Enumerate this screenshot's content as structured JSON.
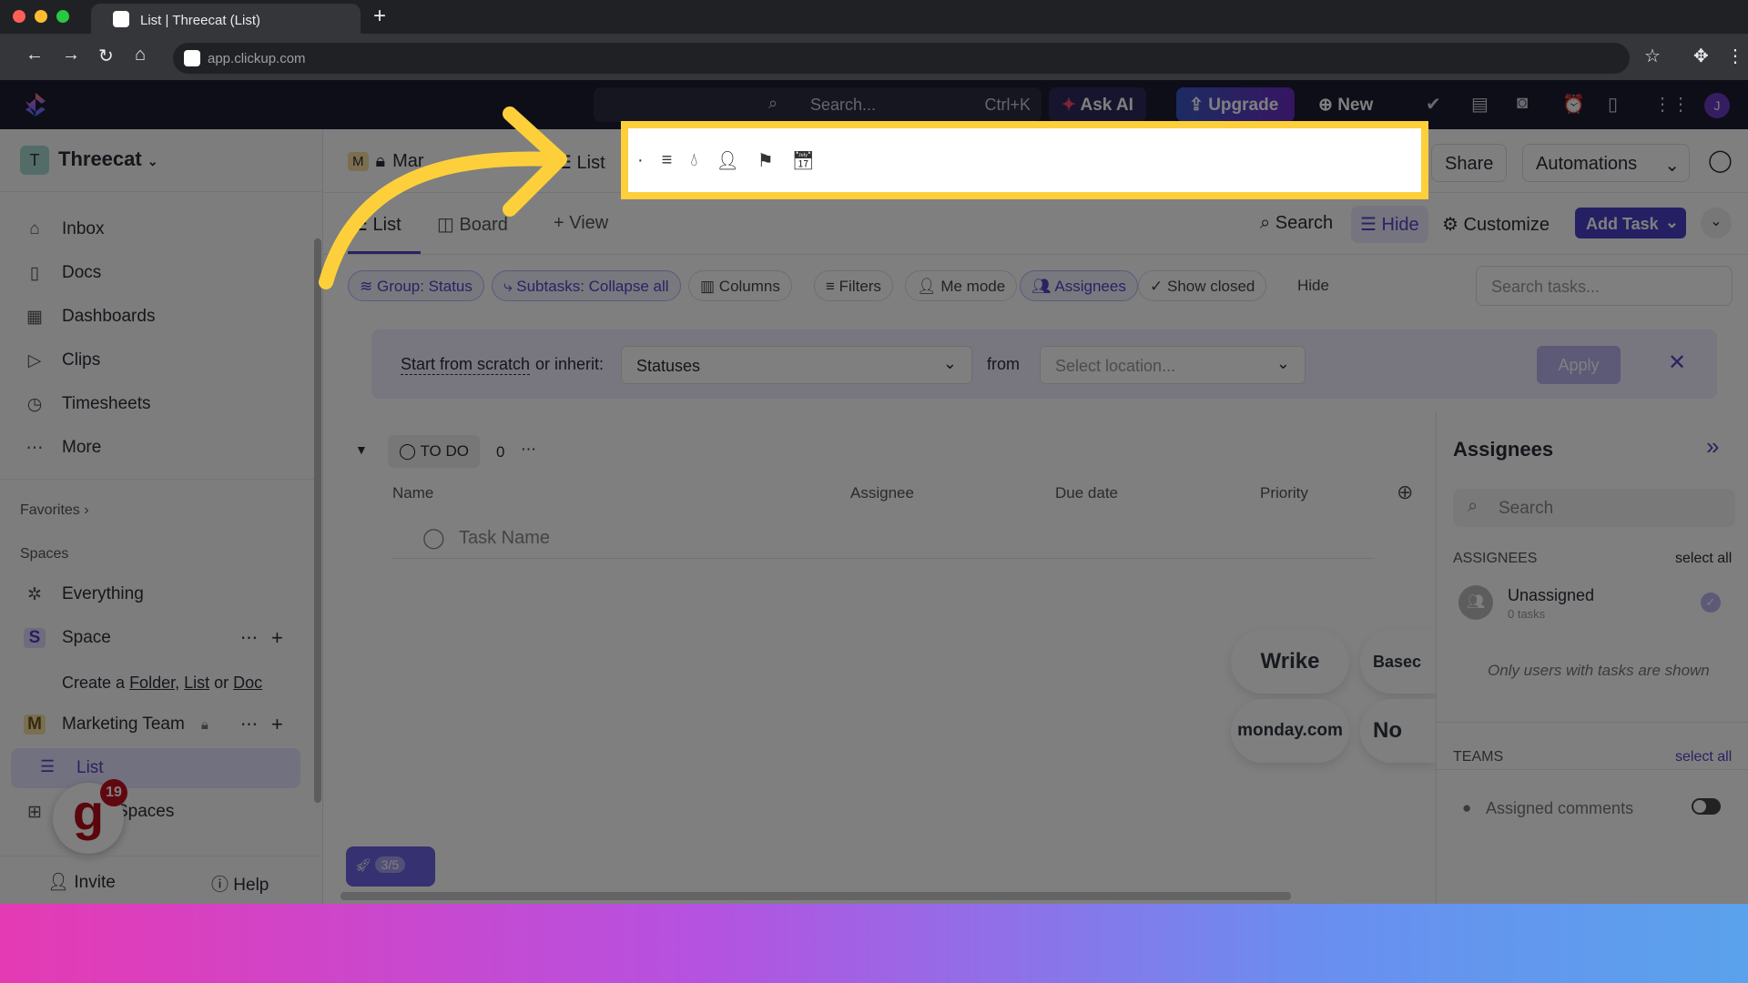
{
  "browser": {
    "tab_title": "List | Threecat (List)",
    "url": "app.clickup.com"
  },
  "header": {
    "search_placeholder": "Search...",
    "shortcut": "Ctrl+K",
    "ask_ai": "Ask AI",
    "upgrade": "Upgrade",
    "new": "New",
    "avatar_initial": "J"
  },
  "sidebar": {
    "workspace": "Threecat",
    "workspace_initial": "T",
    "items": [
      {
        "label": "Inbox",
        "icon": "inbox-icon"
      },
      {
        "label": "Docs",
        "icon": "docs-icon"
      },
      {
        "label": "Dashboards",
        "icon": "dashboard-icon"
      },
      {
        "label": "Clips",
        "icon": "clips-icon"
      },
      {
        "label": "Timesheets",
        "icon": "timer-icon"
      },
      {
        "label": "More",
        "icon": "more-icon"
      }
    ],
    "favorites": "Favorites",
    "spaces": "Spaces",
    "everything": "Everything",
    "space": "Space",
    "space_initial": "S",
    "create_prefix": "Create a",
    "create_folder": "Folder",
    "create_list": "List",
    "create_or": "or",
    "create_doc": "Doc",
    "marketing": "Marketing Team",
    "marketing_initial": "M",
    "list": "List",
    "view_all_spaces": "Spaces",
    "badge": "19",
    "invite": "Invite",
    "help": "Help"
  },
  "breadcrumb": {
    "space_initial": "M",
    "space": "Mar",
    "list": "List"
  },
  "topright": {
    "share": "Share",
    "automations": "Automations"
  },
  "views": {
    "list": "List",
    "board": "Board",
    "add_view": "View",
    "search": "Search",
    "hide": "Hide",
    "customize": "Customize",
    "add_task": "Add Task"
  },
  "filters": {
    "group": "Group: Status",
    "subtasks": "Subtasks: Collapse all",
    "columns": "Columns",
    "filters": "Filters",
    "me_mode": "Me mode",
    "assignees": "Assignees",
    "show_closed": "Show closed",
    "hide": "Hide",
    "search_placeholder": "Search tasks..."
  },
  "banner": {
    "start": "Start from scratch",
    "or_inherit": "or inherit:",
    "statuses": "Statuses",
    "from": "from",
    "location_placeholder": "Select location...",
    "apply": "Apply"
  },
  "group": {
    "status": "TO DO",
    "count": "0",
    "columns": [
      "Name",
      "Assignee",
      "Due date",
      "Priority"
    ],
    "task_placeholder": "Task Name"
  },
  "import_logos": [
    "Wrike",
    "Basec",
    "monday.com",
    "No"
  ],
  "onboarding": {
    "progress": "3/5"
  },
  "assignee_panel": {
    "title": "Assignees",
    "search_placeholder": "Search",
    "section": "ASSIGNEES",
    "select_all": "select all",
    "unassigned": "Unassigned",
    "tasks": "0 tasks",
    "note": "Only users with tasks are shown",
    "teams": "TEAMS",
    "teams_select_all": "select all",
    "assigned_comments": "Assigned comments",
    "assigned_comments_on": false
  },
  "colors": {
    "accent": "#5046c4",
    "highlight": "#fdd03b"
  }
}
